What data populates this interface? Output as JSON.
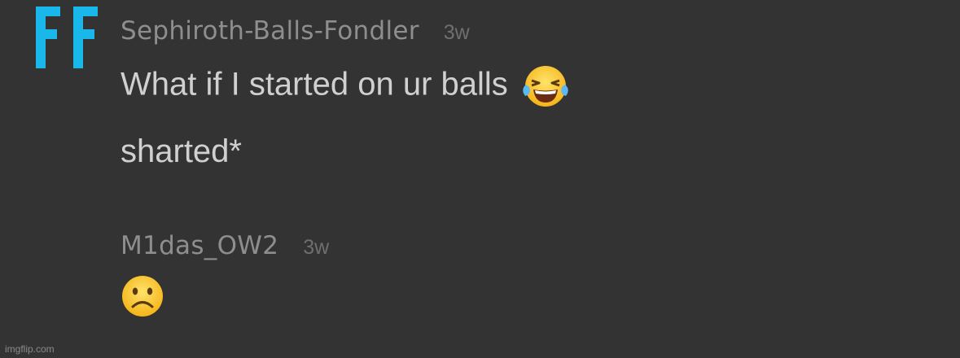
{
  "comments": [
    {
      "username": "Sephiroth-Balls-Fondler",
      "timestamp": "3w",
      "avatar_icon": "ff-logo-icon",
      "avatar_text": "FF",
      "avatar_color": "#1ab7ea",
      "messages": [
        {
          "text": "What if I started on ur balls",
          "emoji_icon": "face-with-tears-of-joy-emoji"
        },
        {
          "text": "sharted*"
        }
      ]
    },
    {
      "username": "M1das_OW2",
      "timestamp": "3w",
      "messages": [
        {
          "text": "",
          "emoji_icon": "frowning-face-emoji"
        }
      ]
    }
  ],
  "colors": {
    "background": "#333333",
    "username": "#8e8e8e",
    "timestamp": "#6f6f6f",
    "message_text": "#d0d0d0"
  },
  "watermark": "imgflip.com"
}
